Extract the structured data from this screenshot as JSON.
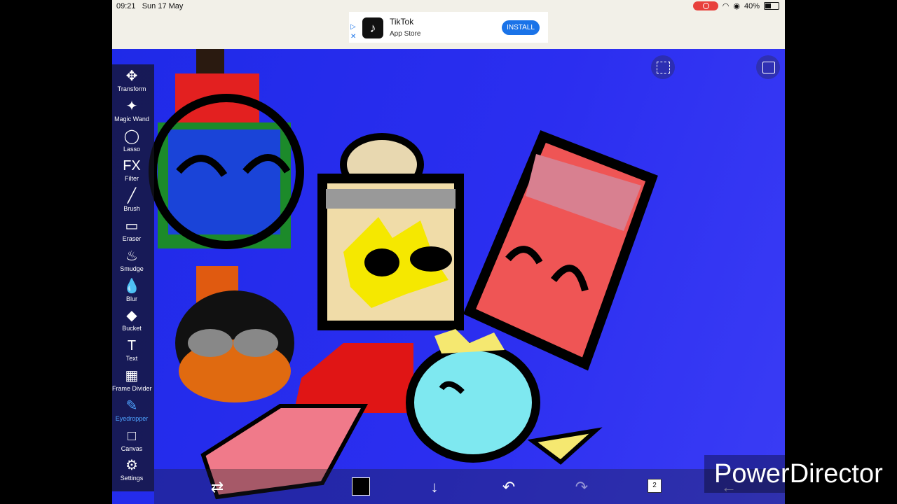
{
  "status_bar": {
    "time": "09:21",
    "date": "Sun 17 May",
    "battery": "40%",
    "battery_level": 0.4
  },
  "ad": {
    "title": "TikTok",
    "subtitle": "App Store",
    "install_label": "INSTALL"
  },
  "tools": [
    {
      "label": "Transform",
      "icon": "move-arrows-icon"
    },
    {
      "label": "Magic Wand",
      "icon": "magic-wand-icon"
    },
    {
      "label": "Lasso",
      "icon": "lasso-icon"
    },
    {
      "label": "Filter",
      "icon": "fx-icon"
    },
    {
      "label": "Brush",
      "icon": "brush-icon"
    },
    {
      "label": "Eraser",
      "icon": "eraser-icon"
    },
    {
      "label": "Smudge",
      "icon": "smudge-icon"
    },
    {
      "label": "Blur",
      "icon": "drop-icon"
    },
    {
      "label": "Bucket",
      "icon": "bucket-icon"
    },
    {
      "label": "Text",
      "icon": "text-icon"
    },
    {
      "label": "Frame Divider",
      "icon": "frame-divider-icon"
    },
    {
      "label": "Eyedropper",
      "icon": "eyedropper-icon",
      "active": true
    },
    {
      "label": "Canvas",
      "icon": "canvas-icon"
    },
    {
      "label": "Settings",
      "icon": "gear-icon"
    }
  ],
  "tool_glyphs": [
    "✥",
    "✦",
    "◯",
    "FX",
    "╱",
    "▭",
    "♨",
    "💧",
    "◆",
    "T",
    "▦",
    "✎",
    "□",
    "⚙"
  ],
  "bottom": {
    "layer_count": "2",
    "current_color": "#000000"
  },
  "watermark": "PowerDirector",
  "colors": {
    "accent": "#4ea3ff",
    "canvas_bg": "#2b2ef0"
  }
}
